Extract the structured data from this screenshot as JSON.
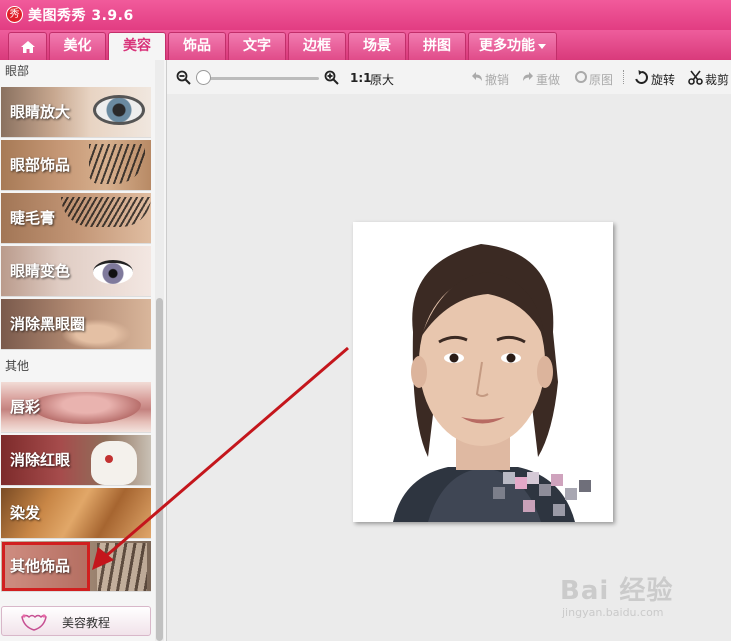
{
  "app": {
    "title": "美图秀秀 3.9.6",
    "logo_text": "秀"
  },
  "tabs": [
    {
      "label": "美化"
    },
    {
      "label": "美容"
    },
    {
      "label": "饰品"
    },
    {
      "label": "文字"
    },
    {
      "label": "边框"
    },
    {
      "label": "场景"
    },
    {
      "label": "拼图"
    },
    {
      "label": "更多功能"
    }
  ],
  "active_tab": "美容",
  "sidebar": {
    "sections": [
      {
        "label": "眼部",
        "items": [
          "眼睛放大",
          "眼部饰品",
          "睫毛膏",
          "眼睛变色",
          "消除黑眼圈"
        ]
      },
      {
        "label": "其他",
        "items": [
          "唇彩",
          "消除红眼",
          "染发",
          "其他饰品"
        ]
      }
    ],
    "highlighted_item": "其他饰品",
    "tutorial_label": "美容教程"
  },
  "toolbar": {
    "ratio_label": "1:1",
    "original_size_label": "原大",
    "undo_label": "撤销",
    "redo_label": "重做",
    "original_image_label": "原图",
    "rotate_label": "旋转",
    "crop_label": "裁剪",
    "zoom_level": 0
  },
  "watermark": {
    "text": "Bai 经验",
    "url": "jingyan.baidu.com"
  },
  "colors": {
    "brand_pink": "#e23d82",
    "annotation_red": "#c4161c"
  },
  "icons": [
    "home-icon",
    "zoom-out-icon",
    "zoom-in-icon",
    "undo-icon",
    "redo-icon",
    "original-icon",
    "rotate-icon",
    "crop-icon",
    "tutorial-hands-icon",
    "dropdown-caret-icon"
  ]
}
